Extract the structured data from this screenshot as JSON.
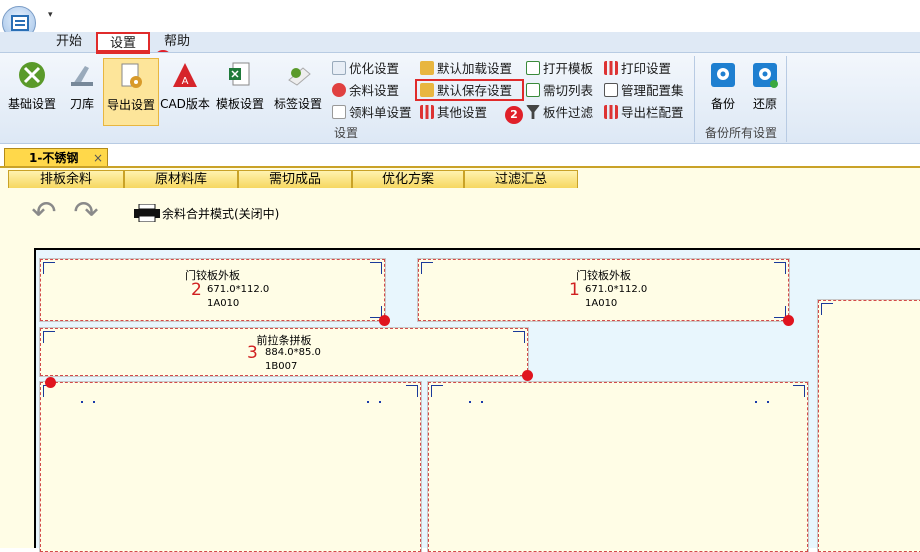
{
  "app": {
    "qat_label": "▾"
  },
  "menu_tabs": [
    "开始",
    "设置",
    "帮助"
  ],
  "ribbon": {
    "big_buttons": [
      "基础设置",
      "刀库",
      "导出设置",
      "CAD版本",
      "模板设置",
      "标签设置"
    ],
    "small_buttons": {
      "col1": [
        "优化设置",
        "余料设置",
        "领料单设置"
      ],
      "col2": [
        "默认加载设置",
        "默认保存设置",
        "其他设置"
      ],
      "col3": [
        "打开模板",
        "需切列表",
        "板件过滤"
      ],
      "col4": [
        "打印设置",
        "管理配置集",
        "导出栏配置"
      ]
    },
    "group_settings_label": "设置",
    "backup_buttons": [
      "备份",
      "还原"
    ],
    "group_backup_label": "备份所有设置"
  },
  "markers": [
    "1",
    "2"
  ],
  "doc_tab": {
    "label": "1-不锈钢",
    "close": "×"
  },
  "sub_tabs": [
    "排板余料",
    "原材料库",
    "需切成品",
    "优化方案",
    "过滤汇总"
  ],
  "toolbar": {
    "merge_label": "余料合并模式(关闭中)"
  },
  "parts": [
    {
      "index": "2",
      "name": "门铰板外板",
      "dims": "671.0*112.0",
      "code": "1A010"
    },
    {
      "index": "1",
      "name": "门铰板外板",
      "dims": "671.0*112.0",
      "code": "1A010"
    },
    {
      "index": "3",
      "name": "前拉条拼板",
      "dims": "884.0*85.0",
      "code": "1B007"
    }
  ],
  "colors": {
    "accent_red": "#e02b2b",
    "ribbon_bg": "#dde8f5",
    "board_bg": "#e8f6fd",
    "part_bg": "#fffde6",
    "tab_yellow": "#ffd84a"
  }
}
